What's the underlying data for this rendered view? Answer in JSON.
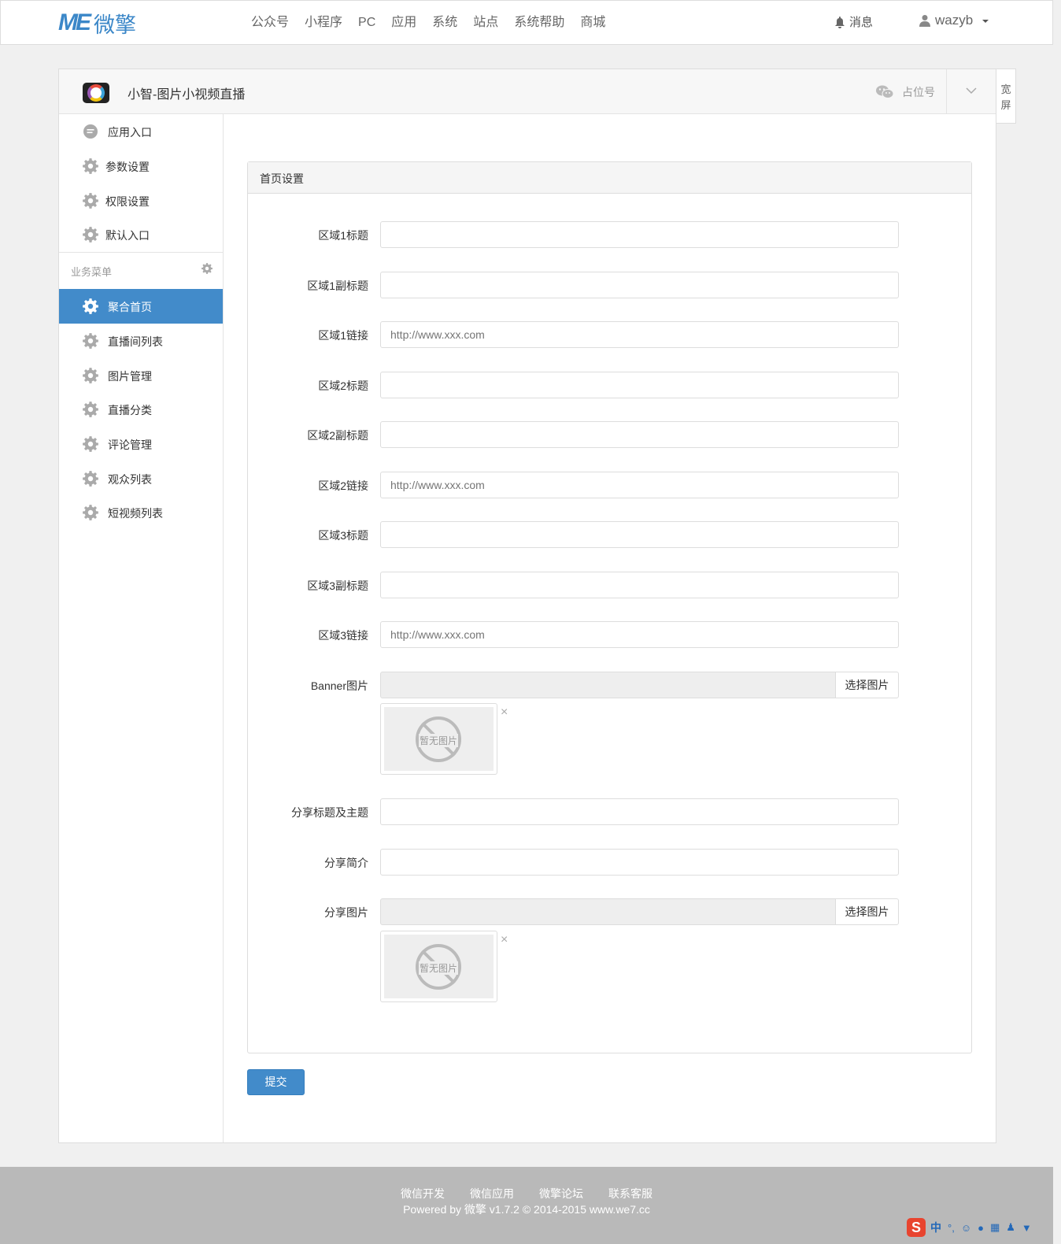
{
  "topbar": {
    "logo_mark": "ME",
    "logo_text": "微擎",
    "nav": [
      "公众号",
      "小程序",
      "PC",
      "应用",
      "系统",
      "站点",
      "系统帮助",
      "商城"
    ],
    "messages_label": "消息",
    "username": "wazyb"
  },
  "panel": {
    "app_title": "小智-图片小视频直播",
    "placeholder_label": "占位号",
    "wide_label": "宽屏"
  },
  "sidebar": {
    "top_items": [
      {
        "label": "应用入口",
        "icon": "chat-icon"
      },
      {
        "label": "参数设置",
        "icon": "gear-icon"
      },
      {
        "label": "权限设置",
        "icon": "gear-icon"
      },
      {
        "label": "默认入口",
        "icon": "gear-icon"
      }
    ],
    "group_label": "业务菜单",
    "items": [
      {
        "label": "聚合首页",
        "icon": "gear-icon",
        "active": true
      },
      {
        "label": "直播间列表",
        "icon": "gear-icon"
      },
      {
        "label": "图片管理",
        "icon": "gear-icon"
      },
      {
        "label": "直播分类",
        "icon": "gear-icon"
      },
      {
        "label": "评论管理",
        "icon": "gear-icon"
      },
      {
        "label": "观众列表",
        "icon": "gear-icon"
      },
      {
        "label": "短视频列表",
        "icon": "gear-icon"
      }
    ]
  },
  "form": {
    "title": "首页设置",
    "fields": [
      {
        "label": "区域1标题",
        "value": "",
        "placeholder": ""
      },
      {
        "label": "区域1副标题",
        "value": "",
        "placeholder": ""
      },
      {
        "label": "区域1链接",
        "value": "",
        "placeholder": "http://www.xxx.com"
      },
      {
        "label": "区域2标题",
        "value": "",
        "placeholder": ""
      },
      {
        "label": "区域2副标题",
        "value": "",
        "placeholder": ""
      },
      {
        "label": "区域2链接",
        "value": "",
        "placeholder": "http://www.xxx.com"
      },
      {
        "label": "区域3标题",
        "value": "",
        "placeholder": ""
      },
      {
        "label": "区域3副标题",
        "value": "",
        "placeholder": ""
      },
      {
        "label": "区域3链接",
        "value": "",
        "placeholder": "http://www.xxx.com"
      }
    ],
    "banner": {
      "label": "Banner图片",
      "button": "选择图片",
      "no_image": "暂无图片"
    },
    "share_title": {
      "label": "分享标题及主题",
      "value": ""
    },
    "share_desc": {
      "label": "分享简介",
      "value": ""
    },
    "share_image": {
      "label": "分享图片",
      "button": "选择图片",
      "no_image": "暂无图片"
    },
    "remove_symbol": "×",
    "submit_label": "提交"
  },
  "footer": {
    "links": [
      "微信开发",
      "微信应用",
      "微擎论坛",
      "联系客服"
    ],
    "copyright": "Powered by 微擎 v1.7.2 © 2014-2015 www.we7.cc"
  },
  "ime": {
    "logo": "S",
    "mode": "中",
    "punct": "°,"
  },
  "colors": {
    "accent": "#428bca",
    "footer_bg": "#b9b9b9",
    "logo": "#3b87c8"
  }
}
